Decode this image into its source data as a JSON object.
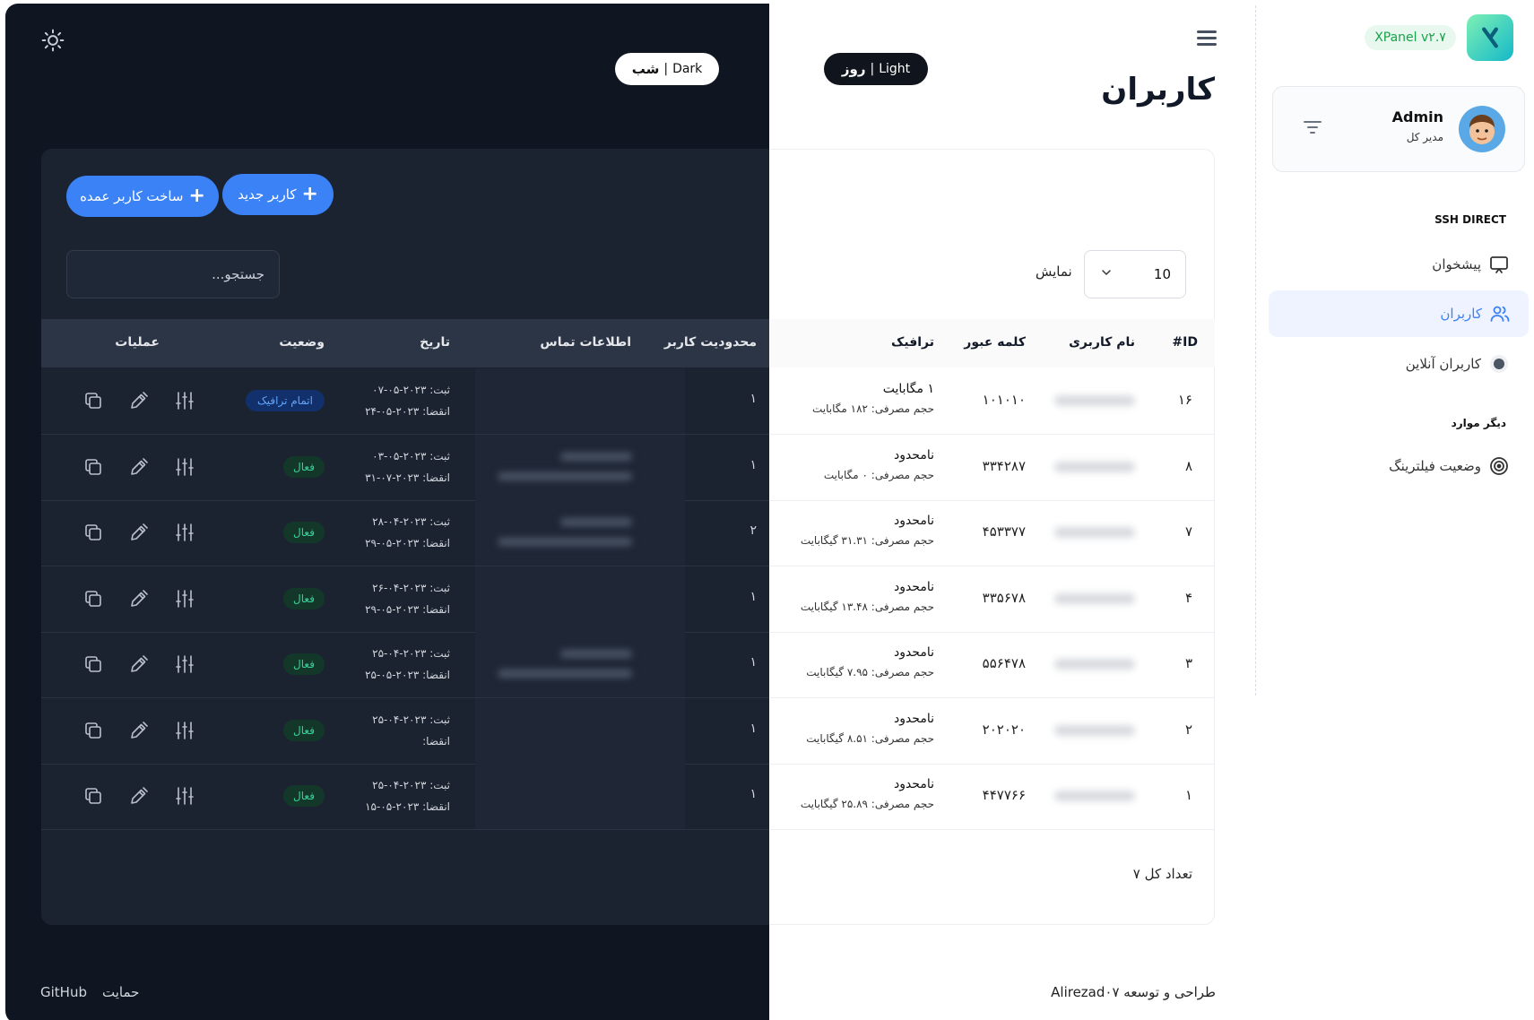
{
  "theme_toggle": {
    "dark_label": "Dark",
    "dark_label_fa": "شب",
    "light_label": "Light",
    "light_label_fa": "روز"
  },
  "page": {
    "title": "کاربران"
  },
  "toolbar": {
    "new_user": "کاربر جدید",
    "bulk_user": "ساخت کاربر عمده",
    "search_placeholder": "جستجو...",
    "show_label": "نمایش",
    "page_size": "10"
  },
  "columns": {
    "id": "ID#",
    "username": "نام کاربری",
    "password": "کلمه عبور",
    "traffic": "ترافیک",
    "limit": "محدودیت کاربر",
    "contact": "اطلاعات تماس",
    "date": "تاریخ",
    "status": "وضعیت",
    "actions": "عملیات"
  },
  "rows": [
    {
      "id": "۱۶",
      "password": "۱۰۱۰۱۰",
      "traffic": "۱ مگابایت",
      "usage": "حجم مصرفی: ۱۸۲ مگابایت",
      "limit": "۱",
      "reg": "ثبت: ۲۰۲۳-۰۵-۰۷",
      "exp": "انقضا: ۲۰۲۳-۰۵-۲۴",
      "status": "اتمام ترافیک",
      "status_type": "ended",
      "contact": false
    },
    {
      "id": "۸",
      "password": "۳۳۴۲۸۷",
      "traffic": "نامحدود",
      "usage": "حجم مصرفی: ۰ مگابایت",
      "limit": "۱",
      "reg": "ثبت: ۲۰۲۳-۰۵-۰۳",
      "exp": "انقضا: ۲۰۲۳-۰۷-۳۱",
      "status": "فعال",
      "status_type": "active",
      "contact": true
    },
    {
      "id": "۷",
      "password": "۴۵۳۳۷۷",
      "traffic": "نامحدود",
      "usage": "حجم مصرفی: ۳۱.۳۱ گیگابایت",
      "limit": "۲",
      "reg": "ثبت: ۲۰۲۳-۰۴-۲۸",
      "exp": "انقضا: ۲۰۲۳-۰۵-۲۹",
      "status": "فعال",
      "status_type": "active",
      "contact": true
    },
    {
      "id": "۴",
      "password": "۳۳۵۶۷۸",
      "traffic": "نامحدود",
      "usage": "حجم مصرفی: ۱۳.۴۸ گیگابایت",
      "limit": "۱",
      "reg": "ثبت: ۲۰۲۳-۰۴-۲۶",
      "exp": "انقضا: ۲۰۲۳-۰۵-۲۹",
      "status": "فعال",
      "status_type": "active",
      "contact": false
    },
    {
      "id": "۳",
      "password": "۵۵۶۴۷۸",
      "traffic": "نامحدود",
      "usage": "حجم مصرفی: ۷.۹۵ گیگابایت",
      "limit": "۱",
      "reg": "ثبت: ۲۰۲۳-۰۴-۲۵",
      "exp": "انقضا: ۲۰۲۳-۰۵-۲۵",
      "status": "فعال",
      "status_type": "active",
      "contact": true
    },
    {
      "id": "۲",
      "password": "۲۰۲۰۲۰",
      "traffic": "نامحدود",
      "usage": "حجم مصرفی: ۸.۵۱ گیگابایت",
      "limit": "۱",
      "reg": "ثبت: ۲۰۲۳-۰۴-۲۵",
      "exp": "انقضا:",
      "status": "فعال",
      "status_type": "active",
      "contact": false
    },
    {
      "id": "۱",
      "password": "۴۴۷۷۶۶",
      "traffic": "نامحدود",
      "usage": "حجم مصرفی: ۲۵.۸۹ گیگابایت",
      "limit": "۱",
      "reg": "ثبت: ۲۰۲۳-۰۴-۲۵",
      "exp": "انقضا: ۲۰۲۳-۰۵-۱۵",
      "status": "فعال",
      "status_type": "active",
      "contact": false
    }
  ],
  "table_footer": {
    "total": "تعداد کل ۷"
  },
  "footer": {
    "github": "GitHub",
    "support": "حمایت",
    "credit": "طراحی و توسعه Alirezad۰۷"
  },
  "sidebar": {
    "version": "XPanel v۲.۷",
    "user_name": "Admin",
    "user_role": "مدیر کل",
    "section_ssh": "SSH DIRECT",
    "section_other": "دیگر موارد",
    "items": [
      {
        "label": "پیشخوان",
        "icon": "monitor-icon"
      },
      {
        "label": "کاربران",
        "icon": "users-icon"
      },
      {
        "label": "کاربران آنلاین",
        "icon": "online-dot-icon"
      },
      {
        "label": "وضعیت فیلترینگ",
        "icon": "target-icon"
      }
    ]
  },
  "colors": {
    "accent": "#3b82f6",
    "dark_bg": "#101621",
    "dark_card": "#1b2331",
    "active_green": "#34d399",
    "version_green": "#16a34a"
  }
}
